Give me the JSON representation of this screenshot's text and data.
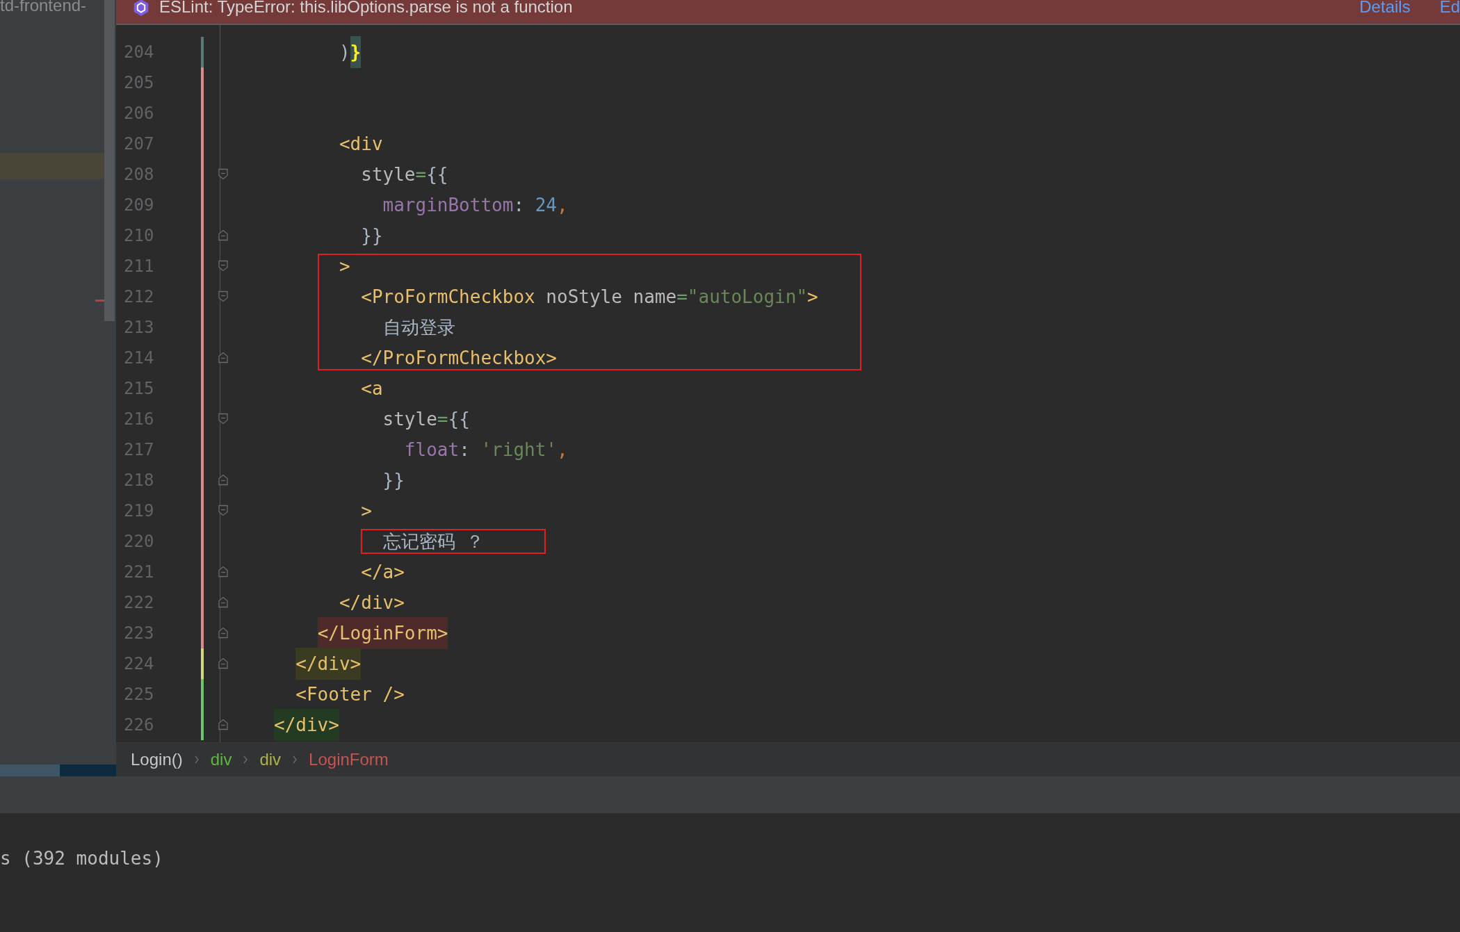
{
  "project_panel": {
    "title": "td-frontend-",
    "selected_row": true
  },
  "notification": {
    "message": "ESLint: TypeError: this.libOptions.parse is not a function",
    "links": [
      "Details",
      "Ed"
    ]
  },
  "editor": {
    "lines": [
      {
        "number": "204",
        "color": "#5a7a7a",
        "fold_start": false,
        "fold_end": false,
        "boxed": false,
        "tokens": [
          {
            "kind": "plain",
            "text": "      )"
          },
          {
            "kind": "brace",
            "text": "}",
            "color": "#3b514d"
          }
        ]
      },
      {
        "number": "205",
        "color": "#d98a8a",
        "fold_start": false,
        "fold_end": false,
        "boxed": false
      },
      {
        "number": "206",
        "color": "#d98a8a",
        "fold_start": false,
        "fold_end": false,
        "boxed": false
      },
      {
        "number": "207",
        "color": "#d98a8a",
        "fold_start": false,
        "fold_end": false,
        "boxed": false,
        "tokens": [
          {
            "kind": "tag",
            "text": "      <div"
          }
        ]
      },
      {
        "number": "208",
        "color": "#d98a8a",
        "fold_start": true,
        "fold_end": false,
        "boxed": false,
        "tokens": [
          {
            "kind": "attr",
            "text": "        style"
          },
          {
            "kind": "operator",
            "text": "="
          },
          {
            "kind": "plain",
            "text": "{{"
          }
        ]
      },
      {
        "number": "209",
        "color": "#d98a8a",
        "fold_start": false,
        "fold_end": false,
        "boxed": false,
        "tokens": [
          {
            "kind": "prop",
            "text": "          marginBottom"
          },
          {
            "kind": "plain",
            "text": ": "
          },
          {
            "kind": "number",
            "text": "24"
          },
          {
            "kind": "comma",
            "text": ","
          }
        ]
      },
      {
        "number": "210",
        "color": "#d98a8a",
        "fold_start": false,
        "fold_end": true,
        "boxed": false,
        "tokens": [
          {
            "kind": "plain",
            "text": "        }}"
          }
        ]
      },
      {
        "number": "211",
        "color": "#d98a8a",
        "fold_start": true,
        "fold_end": false,
        "boxed": true,
        "tokens": [
          {
            "kind": "tag",
            "text": "      >"
          }
        ]
      },
      {
        "number": "212",
        "color": "#d98a8a",
        "fold_start": true,
        "fold_end": false,
        "boxed": true,
        "tokens": [
          {
            "kind": "tag",
            "text": "        <ProFormCheckbox"
          },
          {
            "kind": "attr",
            "text": " noStyle name"
          },
          {
            "kind": "operator",
            "text": "="
          },
          {
            "kind": "string",
            "text": "\"autoLogin\""
          },
          {
            "kind": "tag",
            "text": ">"
          }
        ]
      },
      {
        "number": "213",
        "color": "#d98a8a",
        "fold_start": false,
        "fold_end": false,
        "boxed": true,
        "tokens": [
          {
            "kind": "text",
            "text": "          自动登录"
          }
        ]
      },
      {
        "number": "214",
        "color": "#d98a8a",
        "fold_start": false,
        "fold_end": true,
        "boxed": true,
        "tokens": [
          {
            "kind": "tag",
            "text": "        </ProFormCheckbox>"
          }
        ]
      },
      {
        "number": "215",
        "color": "#d98a8a",
        "fold_start": false,
        "fold_end": false,
        "boxed": false,
        "tokens": [
          {
            "kind": "tag",
            "text": "        <a"
          }
        ]
      },
      {
        "number": "216",
        "color": "#d98a8a",
        "fold_start": true,
        "fold_end": false,
        "boxed": false,
        "tokens": [
          {
            "kind": "attr",
            "text": "          style"
          },
          {
            "kind": "operator",
            "text": "="
          },
          {
            "kind": "plain",
            "text": "{{"
          }
        ]
      },
      {
        "number": "217",
        "color": "#d98a8a",
        "fold_start": false,
        "fold_end": false,
        "boxed": false,
        "tokens": [
          {
            "kind": "prop",
            "text": "            float"
          },
          {
            "kind": "plain",
            "text": ": "
          },
          {
            "kind": "string",
            "text": "'right'"
          },
          {
            "kind": "comma",
            "text": ","
          }
        ]
      },
      {
        "number": "218",
        "color": "#d98a8a",
        "fold_start": false,
        "fold_end": true,
        "boxed": false,
        "tokens": [
          {
            "kind": "plain",
            "text": "          }}"
          }
        ]
      },
      {
        "number": "219",
        "color": "#d98a8a",
        "fold_start": true,
        "fold_end": false,
        "boxed": false,
        "tokens": [
          {
            "kind": "tag",
            "text": "        >"
          }
        ]
      },
      {
        "number": "220",
        "color": "#d98a8a",
        "fold_start": false,
        "fold_end": false,
        "boxed": true,
        "tokens": [
          {
            "kind": "text",
            "text": "          忘记密码 ？"
          }
        ]
      },
      {
        "number": "221",
        "color": "#d98a8a",
        "fold_start": false,
        "fold_end": true,
        "boxed": false,
        "tokens": [
          {
            "kind": "tag",
            "text": "        </a>"
          }
        ]
      },
      {
        "number": "222",
        "color": "#d98a8a",
        "fold_start": false,
        "fold_end": true,
        "boxed": false,
        "tokens": [
          {
            "kind": "tag",
            "text": "      </div>"
          }
        ]
      },
      {
        "number": "223",
        "color": "#d98a8a",
        "fold_start": false,
        "fold_end": true,
        "boxed": false,
        "tokens": [
          {
            "kind": "tag",
            "text": "    </LoginForm>",
            "color": "#4e2a2a"
          }
        ]
      },
      {
        "number": "224",
        "color": "#d6d67a",
        "fold_start": false,
        "fold_end": true,
        "boxed": false,
        "tokens": [
          {
            "kind": "tag",
            "text": "  </div>",
            "color": "#3b3b22"
          }
        ]
      },
      {
        "number": "225",
        "color": "#6fc46f",
        "fold_start": false,
        "fold_end": false,
        "boxed": false,
        "tokens": [
          {
            "kind": "tag",
            "text": "  <Footer />"
          }
        ]
      },
      {
        "number": "226",
        "color": "#6fc46f",
        "fold_start": false,
        "fold_end": true,
        "boxed": false,
        "tokens": [
          {
            "kind": "tag",
            "text": "</div>",
            "color": "#233a23"
          }
        ]
      }
    ]
  },
  "breadcrumbs": [
    {
      "label": "Login()",
      "color": "#c8c8c8"
    },
    {
      "label": "div",
      "color": "#62b543"
    },
    {
      "label": "div",
      "color": "#b0b04a"
    },
    {
      "label": "LoginForm",
      "color": "#c75450"
    }
  ],
  "terminal": {
    "output": "s (392 modules)"
  }
}
